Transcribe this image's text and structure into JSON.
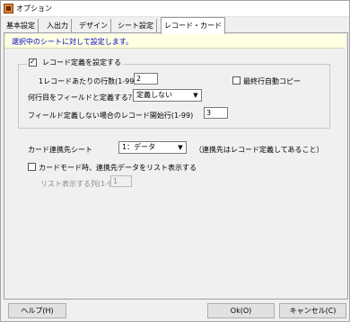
{
  "window": {
    "title": "オプション"
  },
  "tabs": [
    {
      "label": "基本設定"
    },
    {
      "label": "入出力"
    },
    {
      "label": "デザイン"
    },
    {
      "label": "シート設定"
    },
    {
      "label": "レコード・カード"
    }
  ],
  "info": {
    "text": "選択中のシートに対して設定します。"
  },
  "record_group": {
    "checkbox_label": "レコード定義を設定する",
    "checked": true,
    "rows_per_record_label": "1レコードあたりの行数(1-99)",
    "rows_per_record_value": "2",
    "auto_copy_label": "最終行自動コピー",
    "auto_copy_checked": false,
    "field_row_label": "何行目をフィールドと定義する？",
    "field_row_value": "定義しない",
    "start_row_label": "フィールド定義しない場合のレコード開始行(1-99)",
    "start_row_value": "3"
  },
  "card": {
    "target_label": "カード連携先シート",
    "target_value": "1：データ",
    "target_note": "（連携先はレコード定義してあること）",
    "list_mode_label": "カードモード時、連携先データをリスト表示する",
    "list_mode_checked": false,
    "list_columns_label": "リスト表示する列(1-99)",
    "list_columns_value": "1"
  },
  "buttons": {
    "help": "ヘルプ(H)",
    "ok": "Ok(O)",
    "cancel": "キャンセル(C)"
  }
}
